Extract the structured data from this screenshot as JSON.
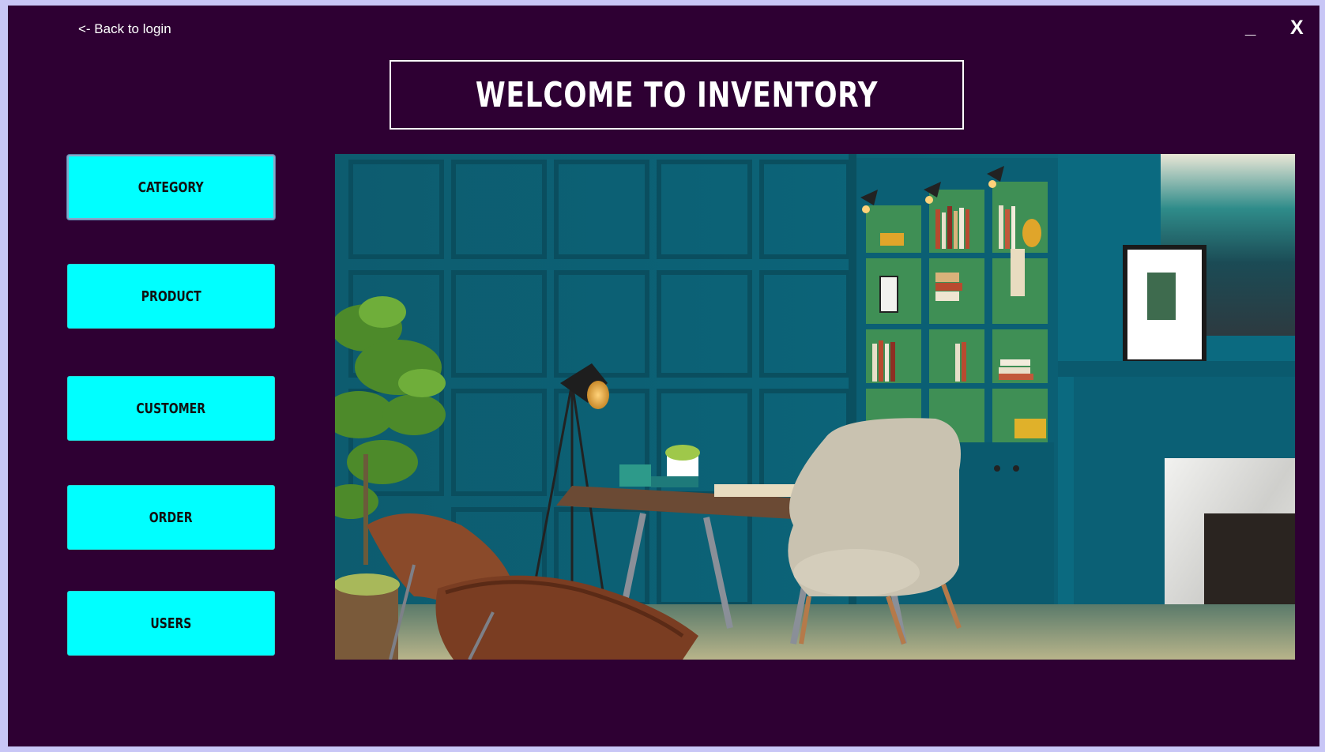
{
  "window": {
    "back_link": "<-  Back to  login",
    "minimize": "_",
    "close": "X"
  },
  "header": {
    "title": "WELCOME TO INVENTORY"
  },
  "nav": {
    "items": [
      {
        "label": "CATEGORY"
      },
      {
        "label": "PRODUCT"
      },
      {
        "label": "CUSTOMER"
      },
      {
        "label": "ORDER"
      },
      {
        "label": "USERS"
      }
    ]
  },
  "colors": {
    "background": "#2e0033",
    "button": "#00ffff",
    "frame": "#c8c6f6",
    "text": "#ffffff"
  }
}
